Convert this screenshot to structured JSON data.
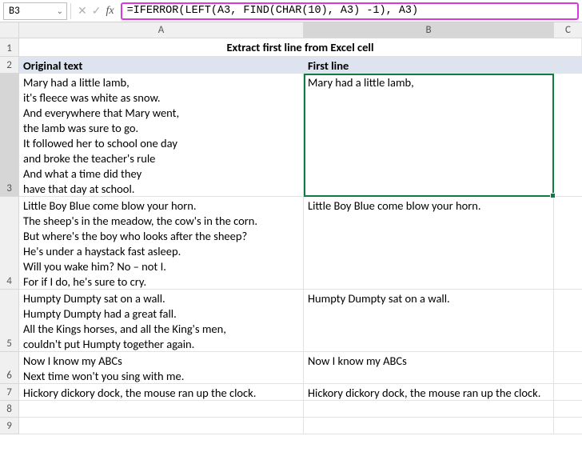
{
  "namebox": {
    "value": "B3"
  },
  "formula": "=IFERROR(LEFT(A3, FIND(CHAR(10), A3) -1), A3)",
  "columns": [
    "A",
    "B",
    "C"
  ],
  "title": "Extract first line from Excel cell",
  "headers": {
    "a": "Original text",
    "b": "First line"
  },
  "rows": [
    {
      "num": "3",
      "height": 154,
      "a": "Mary had a little lamb,\nit's fleece was white as snow.\nAnd everywhere that Mary went,\nthe lamb was sure to go.\nIt followed her to school one day\nand broke the teacher's rule\nAnd what a time did they\nhave that day at school.",
      "b": "Mary had a little lamb,"
    },
    {
      "num": "4",
      "height": 116,
      "a": "Little Boy Blue come blow your horn.\nThe sheep's in the meadow, the cow's in the corn.\nBut where's the boy who looks after the sheep?\nHe's under a haystack fast asleep.\nWill you wake him? No – not I.\nFor if I do, he's sure to cry.",
      "b": "Little Boy Blue come blow your horn."
    },
    {
      "num": "5",
      "height": 78,
      "a": "Humpty Dumpty sat on a wall.\nHumpty Dumpty had a great fall.\nAll the Kings horses, and all the King's men,\ncouldn't put Humpty together again.",
      "b": "Humpty Dumpty sat on a wall."
    },
    {
      "num": "6",
      "height": 40,
      "a": "Now I know my ABCs\nNext time won't you sing with me.",
      "b": "Now I know my ABCs"
    },
    {
      "num": "7",
      "height": 21,
      "a": "Hickory dickory dock, the mouse ran up the clock.",
      "b": "Hickory dickory dock, the mouse ran up the clock."
    },
    {
      "num": "8",
      "height": 21,
      "a": "",
      "b": ""
    },
    {
      "num": "9",
      "height": 21,
      "a": "",
      "b": ""
    }
  ],
  "rowHeights": {
    "title": 23,
    "header": 21
  },
  "rowLabels": {
    "title": "1",
    "header": "2"
  },
  "icons": {
    "cancel": "✕",
    "confirm": "✓",
    "fx": "fx",
    "caret": "⌄"
  }
}
